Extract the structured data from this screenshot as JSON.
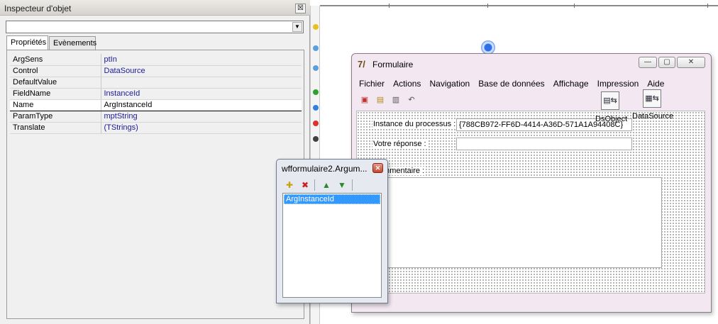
{
  "inspector": {
    "title": "Inspecteur d'objet",
    "close_glyph": "☒",
    "combo_value": "",
    "combo_arrow": "▼",
    "tabs": [
      {
        "label": "Propriétés"
      },
      {
        "label": "Evènements"
      }
    ],
    "properties": [
      {
        "name": "ArgSens",
        "value": "ptIn"
      },
      {
        "name": "Control",
        "value": "DataSource"
      },
      {
        "name": "DefaultValue",
        "value": ""
      },
      {
        "name": "FieldName",
        "value": "InstanceId"
      },
      {
        "name": "Name",
        "value": "ArgInstanceId"
      },
      {
        "name": "ParamType",
        "value": "mptString"
      },
      {
        "name": "Translate",
        "value": "(TStrings)"
      }
    ],
    "selected_property": "Name"
  },
  "form_window": {
    "title": "Formulaire",
    "app_icon": "7/",
    "buttons": {
      "minimize": "—",
      "maximize": "▢",
      "close": "✕"
    },
    "menu": [
      "Fichier",
      "Actions",
      "Navigation",
      "Base de données",
      "Affichage",
      "Impression",
      "Aide"
    ],
    "toolbar_glyphs": [
      "▣",
      "▤",
      "▥",
      "↶"
    ],
    "components": [
      {
        "label": "DsObject",
        "glyph": "▤⇆"
      },
      {
        "label": "DataSource",
        "glyph": "▦⇆"
      }
    ],
    "fields": {
      "process_label": "Instance du processus :",
      "process_value": "{788CB972-FF6D-4414-A36D-571A1A94408C}",
      "answer_label": "Votre réponse :",
      "answer_value": "",
      "comment_label": "Commentaire :"
    }
  },
  "arg_window": {
    "title": "wfformulaire2.Argum...",
    "close_glyph": "✕",
    "toolbar_glyphs": [
      "✚",
      "✖",
      "▲",
      "▼"
    ],
    "items": [
      "ArgInstanceId"
    ]
  },
  "colors": {
    "selection": "#3399ff",
    "value_text": "#1a1aa0",
    "form_frame": "#f3e8f2"
  }
}
